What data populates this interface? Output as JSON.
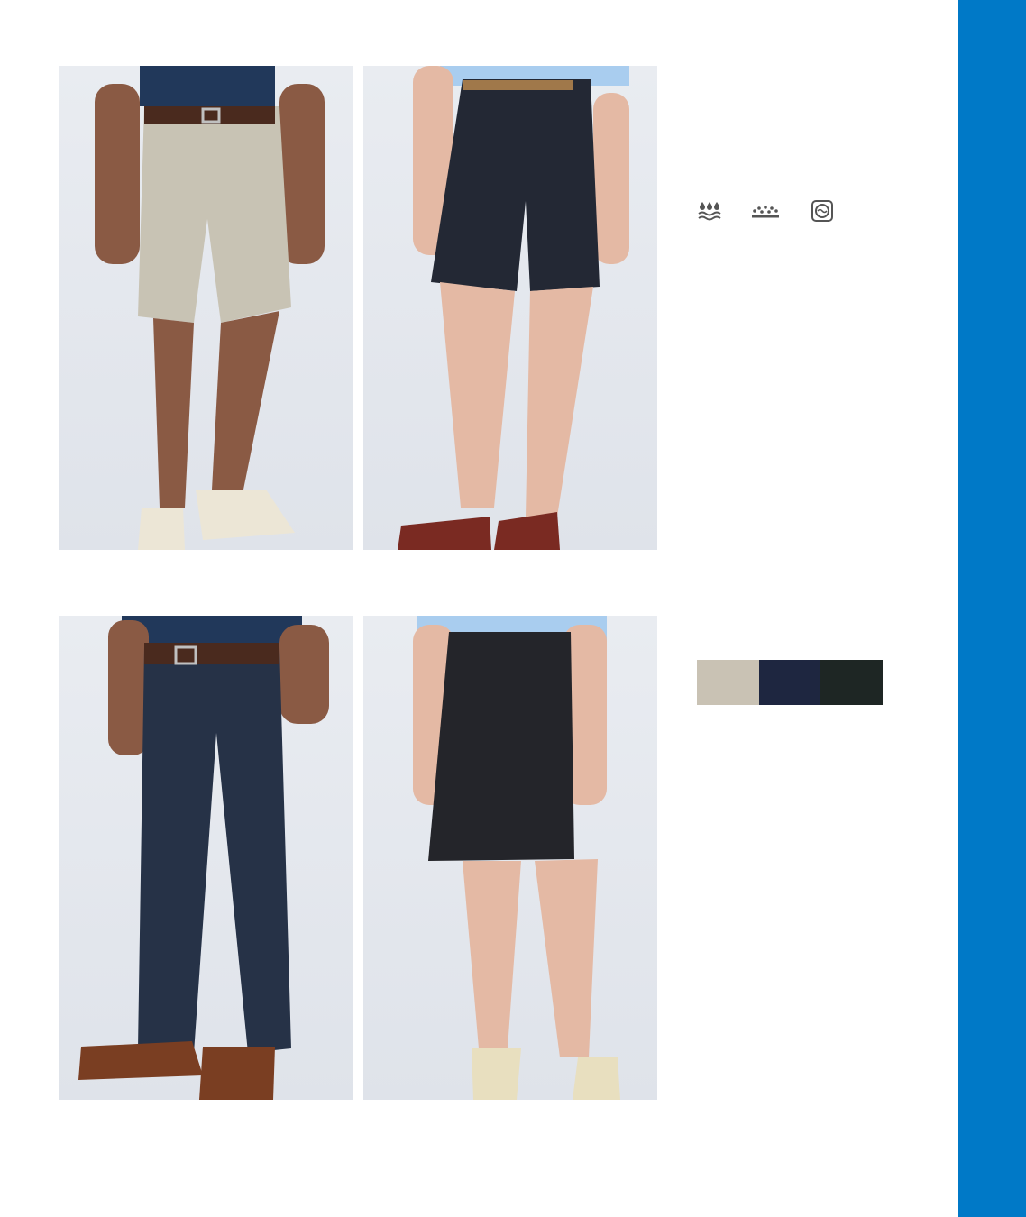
{
  "theme": {
    "side_bar_color": "#0079c7"
  },
  "photos": [
    {
      "name": "mens-khaki-shorts-photo",
      "garment": "#c8c3b4",
      "top": "#21385a"
    },
    {
      "name": "womens-navy-shorts-photo",
      "garment": "#232834",
      "top": "#a9cdef"
    },
    {
      "name": "mens-navy-pleated-pants-photo",
      "garment": "#263247",
      "top": "#21385a"
    },
    {
      "name": "womens-black-skirt-photo",
      "garment": "#24252a",
      "top": "#a9cdef"
    }
  ],
  "care_icons": [
    "water-wash-icon",
    "dry-flat-icon",
    "tumble-dry-icon"
  ],
  "swatches": [
    "#c9c2b4",
    "#1e2640",
    "#1e2624"
  ]
}
